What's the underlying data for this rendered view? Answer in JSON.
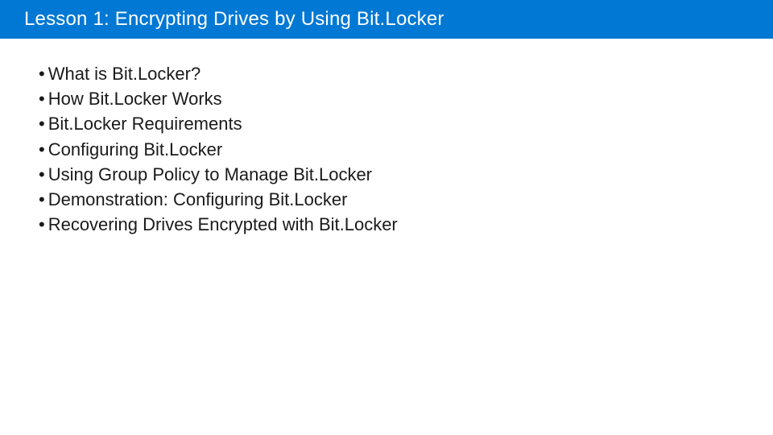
{
  "title": "Lesson 1: Encrypting Drives by Using Bit.Locker",
  "bullets": [
    "What is Bit.Locker?",
    "How Bit.Locker Works",
    "Bit.Locker Requirements",
    "Configuring Bit.Locker",
    "Using Group Policy to Manage Bit.Locker",
    "Demonstration: Configuring Bit.Locker",
    "Recovering Drives Encrypted with Bit.Locker"
  ]
}
